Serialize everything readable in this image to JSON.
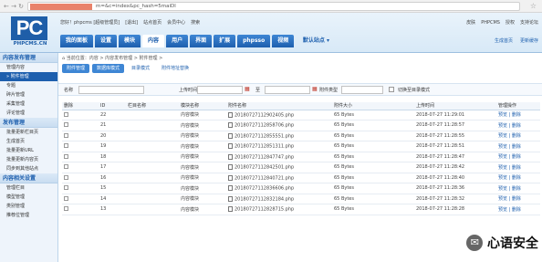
{
  "browser": {
    "nav": "← → ↻",
    "url": "m=&c=index&pc_hash=5maiDl",
    "star": "☆"
  },
  "header": {
    "logo_text": "PC",
    "logo_sub": "PHPCMS.CN",
    "info": [
      "您好！phpcms [超级管理员]",
      "[退出]",
      "站点首页",
      "会员中心",
      "搜索"
    ],
    "right": [
      "皮肤",
      "PHPCMS",
      "授权",
      "支持论坛"
    ],
    "tabs": [
      "我的面板",
      "设置",
      "模块",
      "内容",
      "用户",
      "界面",
      "扩展",
      "phpsso",
      "视频"
    ],
    "active_tab": "内容",
    "site": "默认站点 ▾",
    "shortcuts": [
      "生成首页",
      "更新缓存"
    ]
  },
  "sidebar": [
    {
      "type": "group",
      "label": "内容发布管理"
    },
    {
      "type": "item",
      "label": "管理内容"
    },
    {
      "type": "item",
      "label": "» 附件管理",
      "active": true
    },
    {
      "type": "item",
      "label": "专题"
    },
    {
      "type": "item",
      "label": "碎片管理"
    },
    {
      "type": "item",
      "label": "采集管理"
    },
    {
      "type": "item",
      "label": "评论管理"
    },
    {
      "type": "group",
      "label": "发布管理"
    },
    {
      "type": "item",
      "label": "批量更新栏目页"
    },
    {
      "type": "item",
      "label": "生成首页"
    },
    {
      "type": "item",
      "label": "批量更新URL"
    },
    {
      "type": "item",
      "label": "批量更新内容页"
    },
    {
      "type": "item",
      "label": "同步到其他站点"
    },
    {
      "type": "group",
      "label": "内容相关设置"
    },
    {
      "type": "item",
      "label": "管理栏目"
    },
    {
      "type": "item",
      "label": "模型管理"
    },
    {
      "type": "item",
      "label": "类别管理"
    },
    {
      "type": "item",
      "label": "推荐位管理"
    }
  ],
  "content": {
    "breadcrumb": "⌂ 当前位置：内容 > 内容发布管理 > 附件管理 >",
    "subtabs": [
      {
        "label": "附件管理",
        "btn": true
      },
      {
        "label": "数据库模式",
        "btn": true
      },
      {
        "label": "目录模式",
        "btn": false
      },
      {
        "label": "附件地址替换",
        "btn": false
      }
    ],
    "filter": {
      "name_label": "名称",
      "time_label": "上传时间",
      "to_label": "至",
      "type_label": "附件类型",
      "type_value": "",
      "switch_label": "切换至目录模式"
    },
    "columns": [
      "删除",
      "ID",
      "栏目名称",
      "模块名称",
      "附件名称",
      "附件大小",
      "上传时间",
      "管理操作"
    ],
    "rows": [
      {
        "id": "22",
        "cat": "",
        "module": "内容模块",
        "name": "20180727112902405.php",
        "size": "65 Bytes",
        "time": "2018-07-27 11:29:01",
        "ops": "预览 | 删除"
      },
      {
        "id": "21",
        "cat": "",
        "module": "内容模块",
        "name": "20180727112858706.php",
        "size": "65 Bytes",
        "time": "2018-07-27 11:28:57",
        "ops": "预览 | 删除"
      },
      {
        "id": "20",
        "cat": "",
        "module": "内容模块",
        "name": "20180727112855551.php",
        "size": "65 Bytes",
        "time": "2018-07-27 11:28:55",
        "ops": "预览 | 删除"
      },
      {
        "id": "19",
        "cat": "",
        "module": "内容模块",
        "name": "20180727112851311.php",
        "size": "65 Bytes",
        "time": "2018-07-27 11:28:51",
        "ops": "预览 | 删除"
      },
      {
        "id": "18",
        "cat": "",
        "module": "内容模块",
        "name": "20180727112847747.php",
        "size": "65 Bytes",
        "time": "2018-07-27 11:28:47",
        "ops": "预览 | 删除"
      },
      {
        "id": "17",
        "cat": "",
        "module": "内容模块",
        "name": "20180727112842501.php",
        "size": "65 Bytes",
        "time": "2018-07-27 11:28:42",
        "ops": "预览 | 删除"
      },
      {
        "id": "16",
        "cat": "",
        "module": "内容模块",
        "name": "20180727112840721.php",
        "size": "65 Bytes",
        "time": "2018-07-27 11:28:40",
        "ops": "预览 | 删除"
      },
      {
        "id": "15",
        "cat": "",
        "module": "内容模块",
        "name": "20180727112836606.php",
        "size": "65 Bytes",
        "time": "2018-07-27 11:28:36",
        "ops": "预览 | 删除"
      },
      {
        "id": "14",
        "cat": "",
        "module": "内容模块",
        "name": "20180727112832184.php",
        "size": "65 Bytes",
        "time": "2018-07-27 11:28:32",
        "ops": "预览 | 删除"
      },
      {
        "id": "13",
        "cat": "",
        "module": "内容模块",
        "name": "20180727112828715.php",
        "size": "65 Bytes",
        "time": "2018-07-27 11:28:28",
        "ops": "预览 | 删除"
      }
    ]
  },
  "watermark": {
    "text": "心语安全",
    "icon": "wechat-icon"
  },
  "colors": {
    "accent": "#1d5fae",
    "header_bg": "#d8e9f7",
    "redaction": "#e9826a"
  }
}
